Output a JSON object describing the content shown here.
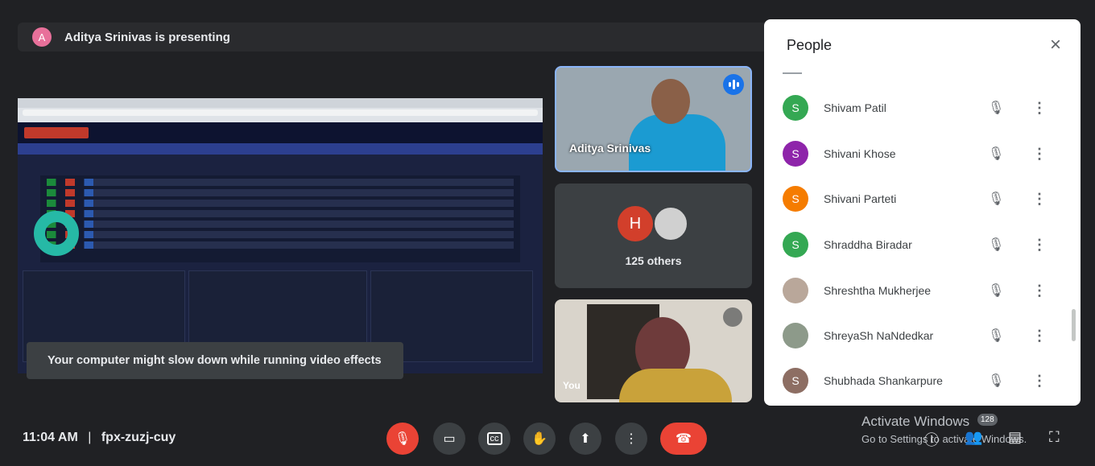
{
  "presenter": {
    "avatar_letter": "A",
    "text": "Aditya Srinivas is presenting"
  },
  "toast": {
    "text": "Your computer might slow down while running video effects"
  },
  "tiles": {
    "main_speaker": {
      "name": "Aditya Srinivas"
    },
    "others": {
      "avatar_letter": "H",
      "label": "125 others"
    },
    "self": {
      "label": "You"
    }
  },
  "people_panel": {
    "title": "People",
    "close_icon": "×",
    "participants": [
      {
        "letter": "S",
        "name": "Shivam Patil",
        "color": "#34a853"
      },
      {
        "letter": "S",
        "name": "Shivani Khose",
        "color": "#8e24aa"
      },
      {
        "letter": "S",
        "name": "Shivani Parteti",
        "color": "#f57c00"
      },
      {
        "letter": "S",
        "name": "Shraddha Biradar",
        "color": "#34a853"
      },
      {
        "letter": "",
        "name": "Shreshtha Mukherjee",
        "color": "#b9a79a"
      },
      {
        "letter": "",
        "name": "ShreyaSh NaNdedkar",
        "color": "#8d9a8a"
      },
      {
        "letter": "S",
        "name": "Shubhada Shankarpure",
        "color": "#8d6e63"
      }
    ]
  },
  "meeting": {
    "time": "11:04 AM",
    "separator": "|",
    "code": "fpx-zuzj-cuy"
  },
  "watermark": {
    "line1": "Activate Windows",
    "line2": "Go to Settings to activate Windows."
  },
  "participant_count_badge": "128"
}
